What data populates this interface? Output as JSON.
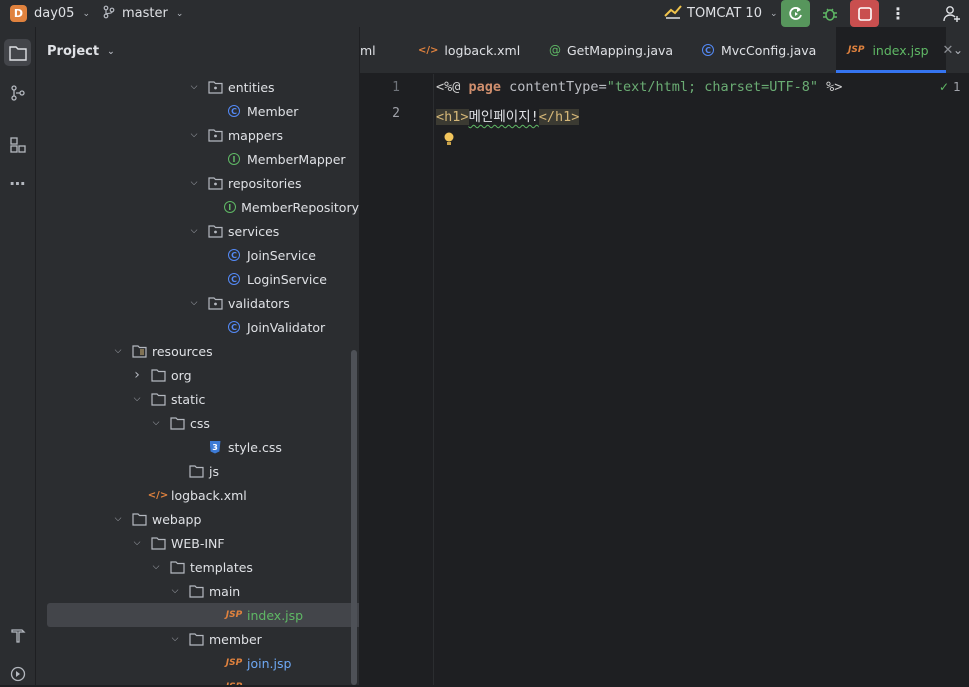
{
  "toolbar": {
    "project_initial": "D",
    "project_name": "day05",
    "branch": "master",
    "run_config": "TOMCAT 10"
  },
  "project_panel": {
    "title": "Project",
    "tree": [
      {
        "label": "entities",
        "type": "package",
        "depth": 0,
        "arrow": "open"
      },
      {
        "label": "Member",
        "type": "class",
        "depth": 1
      },
      {
        "label": "mappers",
        "type": "package",
        "depth": 0,
        "arrow": "open"
      },
      {
        "label": "MemberMapper",
        "type": "interface",
        "depth": 1
      },
      {
        "label": "repositories",
        "type": "package",
        "depth": 0,
        "arrow": "open"
      },
      {
        "label": "MemberRepository",
        "type": "interface",
        "depth": 1
      },
      {
        "label": "services",
        "type": "package",
        "depth": 0,
        "arrow": "open"
      },
      {
        "label": "JoinService",
        "type": "class",
        "depth": 1
      },
      {
        "label": "LoginService",
        "type": "class",
        "depth": 1
      },
      {
        "label": "validators",
        "type": "package",
        "depth": 0,
        "arrow": "open"
      },
      {
        "label": "JoinValidator",
        "type": "class",
        "depth": 1
      },
      {
        "label": "resources",
        "type": "resources-folder",
        "depth": -4,
        "arrow": "open"
      },
      {
        "label": "org",
        "type": "folder",
        "depth": -3,
        "arrow": "closed"
      },
      {
        "label": "static",
        "type": "folder",
        "depth": -3,
        "arrow": "open"
      },
      {
        "label": "css",
        "type": "folder",
        "depth": -2,
        "arrow": "open"
      },
      {
        "label": "style.css",
        "type": "css",
        "depth": 0
      },
      {
        "label": "js",
        "type": "folder",
        "depth": -1
      },
      {
        "label": "logback.xml",
        "type": "xml",
        "depth": -3
      },
      {
        "label": "webapp",
        "type": "folder",
        "depth": -4,
        "arrow": "open"
      },
      {
        "label": "WEB-INF",
        "type": "folder",
        "depth": -3,
        "arrow": "open"
      },
      {
        "label": "templates",
        "type": "folder",
        "depth": -2,
        "arrow": "open"
      },
      {
        "label": "main",
        "type": "folder",
        "depth": -1,
        "arrow": "open"
      },
      {
        "label": "index.jsp",
        "type": "jsp",
        "depth": 1,
        "selected": true,
        "color": "green"
      },
      {
        "label": "member",
        "type": "folder",
        "depth": -1,
        "arrow": "open"
      },
      {
        "label": "join.jsp",
        "type": "jsp",
        "depth": 1,
        "color": "blue"
      },
      {
        "label": "",
        "type": "jsp",
        "depth": 1
      }
    ]
  },
  "tabs": [
    {
      "label": "ml",
      "icon": "none"
    },
    {
      "label": "logback.xml",
      "icon": "xml"
    },
    {
      "label": "GetMapping.java",
      "icon": "annotation"
    },
    {
      "label": "MvcConfig.java",
      "icon": "class"
    },
    {
      "label": "index.jsp",
      "icon": "jsp",
      "active": true
    }
  ],
  "editor": {
    "line_numbers": [
      "1",
      "2"
    ],
    "line1": {
      "open": "<%@ ",
      "keyword": "page",
      "attr": " contentType=",
      "value": "\"text/html; charset=UTF-8\"",
      "close": " %>"
    },
    "line2": {
      "open_tag": "<h1>",
      "text": "메인페이지!",
      "close_tag": "</h1>"
    },
    "inspection_count": "1"
  },
  "colors": {
    "accent": "#3574f0",
    "run": "#57965c",
    "stop": "#c94f4f",
    "project_badge": "#e0823e"
  }
}
